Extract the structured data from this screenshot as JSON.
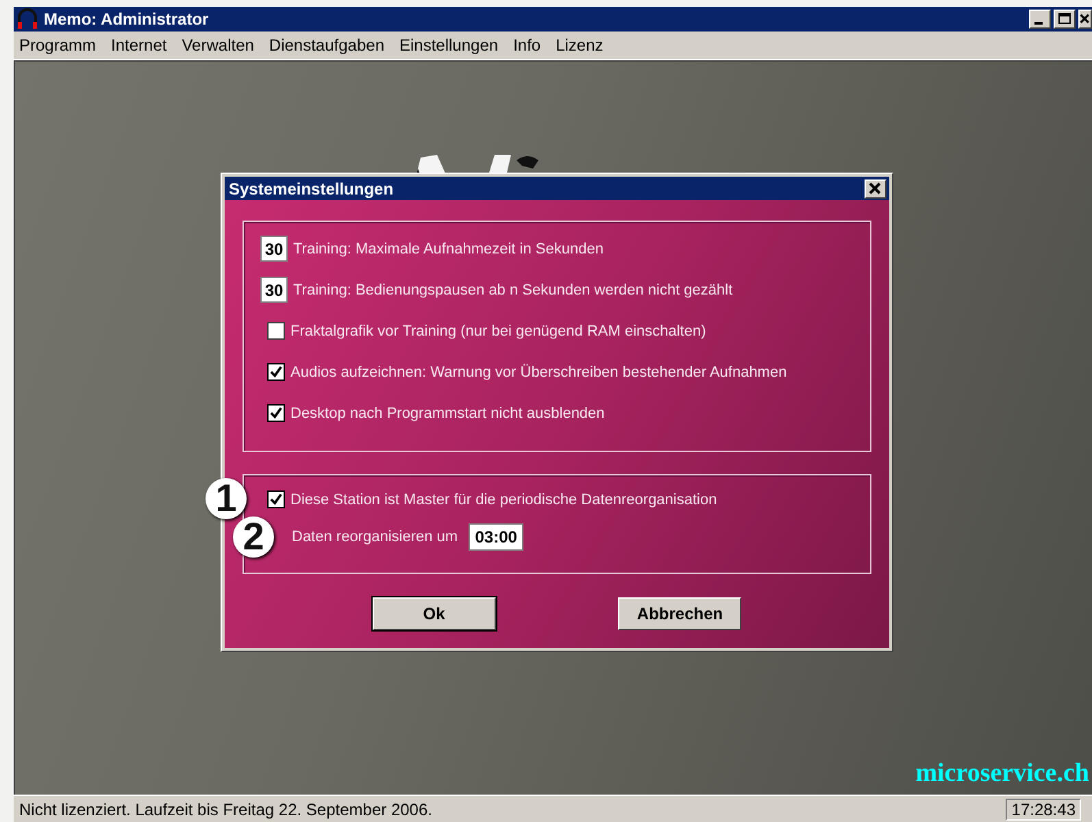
{
  "window": {
    "title": "Memo: Administrator"
  },
  "menu": [
    "Programm",
    "Internet",
    "Verwalten",
    "Dienstaufgaben",
    "Einstellungen",
    "Info",
    "Lizenz"
  ],
  "dialog": {
    "title": "Systemeinstellungen",
    "group_1": [
      {
        "kind": "number",
        "value": "30",
        "label": "Training: Maximale Aufnahmezeit in Sekunden"
      },
      {
        "kind": "number",
        "value": "30",
        "label": "Training: Bedienungspausen ab n Sekunden werden nicht gezählt"
      },
      {
        "kind": "checkbox",
        "checked": false,
        "label": "Fraktalgrafik vor Training (nur bei genügend RAM einschalten)"
      },
      {
        "kind": "checkbox",
        "checked": true,
        "label": "Audios aufzeichnen: Warnung vor Überschreiben bestehender Aufnahmen"
      },
      {
        "kind": "checkbox",
        "checked": true,
        "label": "Desktop nach Programmstart nicht ausblenden"
      }
    ],
    "group_2": [
      {
        "kind": "checkbox",
        "checked": true,
        "label": "Diese Station ist Master für die periodische Datenreorganisation",
        "callout": "1"
      },
      {
        "kind": "time",
        "label": "Daten reorganisieren um",
        "value": "03:00",
        "callout": "2"
      }
    ],
    "buttons": [
      {
        "label": "Ok",
        "default": true
      },
      {
        "label": "Abbrechen",
        "default": false
      }
    ]
  },
  "brand": "microservice.ch",
  "status_bar": {
    "message": "Nicht lizenziert. Laufzeit bis Freitag 22. September 2006.",
    "clock": "17:28:43"
  }
}
